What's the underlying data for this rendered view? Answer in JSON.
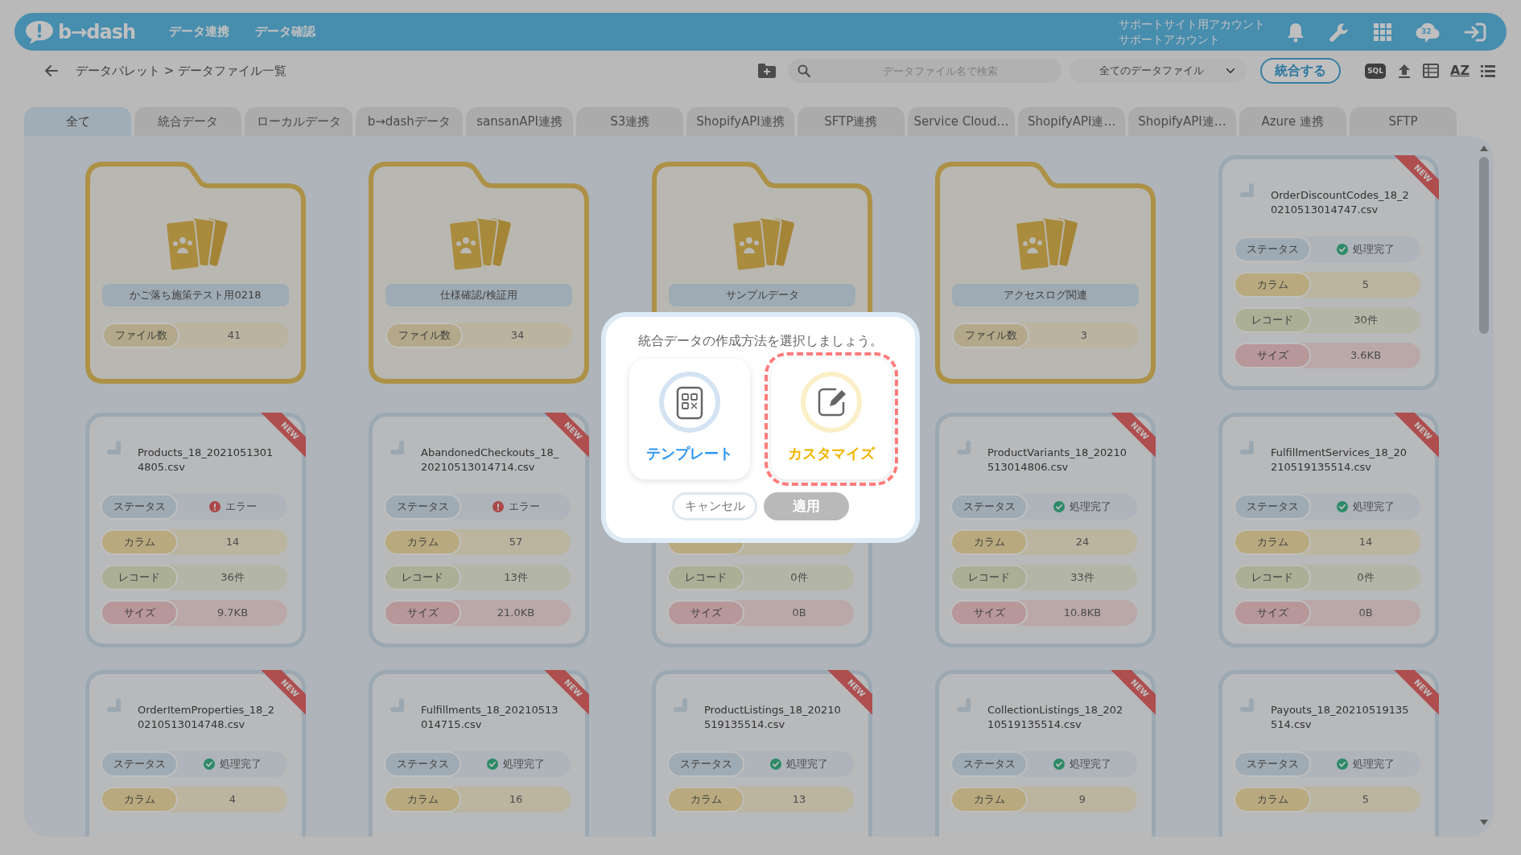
{
  "header": {
    "logo": "b→dash",
    "nav": [
      {
        "label": "データ連携"
      },
      {
        "label": "データ確認"
      }
    ],
    "account": [
      "サポートサイト用アカウント",
      "サポートアカウント"
    ],
    "badge": "32"
  },
  "toolbar": {
    "breadcrumb": "データパレット > データファイル一覧",
    "search": {
      "placeholder": "データファイル名で検索"
    },
    "filter": "全てのデータファイル",
    "merge_button": "統合する",
    "sql_button": "SQL",
    "sort_button": "AZ"
  },
  "tabs": [
    {
      "label": "全て",
      "selected": true
    },
    {
      "label": "統合データ",
      "selected": false
    },
    {
      "label": "ローカルデータ",
      "selected": false
    },
    {
      "label": "b→dashデータ",
      "selected": false
    },
    {
      "label": "sansanAPI連携",
      "selected": false
    },
    {
      "label": "S3連携",
      "selected": false
    },
    {
      "label": "ShopifyAPI連携",
      "selected": false
    },
    {
      "label": "SFTP連携",
      "selected": false
    },
    {
      "label": "Service Cloud…",
      "selected": false
    },
    {
      "label": "ShopifyAPI連…",
      "selected": false
    },
    {
      "label": "ShopifyAPI連…",
      "selected": false
    },
    {
      "label": "Azure 連携",
      "selected": false
    },
    {
      "label": "SFTP",
      "selected": false
    }
  ],
  "items": [
    {
      "kind": "folder",
      "name": "かご落ち施策テスト用0218",
      "count_label": "ファイル数",
      "count": "41"
    },
    {
      "kind": "folder",
      "name": "仕様確認/検証用",
      "count_label": "ファイル数",
      "count": "34"
    },
    {
      "kind": "folder",
      "name": "サンプルデータ"
    },
    {
      "kind": "folder",
      "name": "アクセスログ関連",
      "count_label": "ファイル数",
      "count": "3"
    },
    {
      "kind": "file",
      "name": "OrderDiscountCodes_18_20210513014747.csv",
      "ribbon": "NEW",
      "rows": [
        {
          "kind": "status",
          "label": "ステータス",
          "value": "処理完了",
          "error": false
        },
        {
          "kind": "column",
          "label": "カラム",
          "value": "5"
        },
        {
          "kind": "record",
          "label": "レコード",
          "value": "30件"
        },
        {
          "kind": "size",
          "label": "サイズ",
          "value": "3.6KB"
        }
      ]
    },
    {
      "kind": "file",
      "name": "Products_18_20210513014805.csv",
      "ribbon": "NEW",
      "rows": [
        {
          "kind": "status",
          "label": "ステータス",
          "value": "エラー",
          "error": true
        },
        {
          "kind": "column",
          "label": "カラム",
          "value": "14"
        },
        {
          "kind": "record",
          "label": "レコード",
          "value": "36件"
        },
        {
          "kind": "size",
          "label": "サイズ",
          "value": "9.7KB"
        }
      ]
    },
    {
      "kind": "file",
      "name": "AbandonedCheckouts_18_20210513014714.csv",
      "ribbon": "NEW",
      "rows": [
        {
          "kind": "status",
          "label": "ステータス",
          "value": "エラー",
          "error": true
        },
        {
          "kind": "column",
          "label": "カラム",
          "value": "57"
        },
        {
          "kind": "record",
          "label": "レコード",
          "value": "13件"
        },
        {
          "kind": "size",
          "label": "サイズ",
          "value": "21.0KB"
        }
      ]
    },
    {
      "kind": "file",
      "rows": [
        {
          "kind": "column"
        },
        {
          "kind": "record",
          "label": "レコード",
          "value": "0件"
        },
        {
          "kind": "size",
          "label": "サイズ",
          "value": "0B"
        }
      ]
    },
    {
      "kind": "file",
      "name": "ProductVariants_18_20210513014806.csv",
      "ribbon": "NEW",
      "rows": [
        {
          "kind": "status",
          "label": "ステータス",
          "value": "処理完了",
          "error": false
        },
        {
          "kind": "column",
          "label": "カラム",
          "value": "24"
        },
        {
          "kind": "record",
          "label": "レコード",
          "value": "33件"
        },
        {
          "kind": "size",
          "label": "サイズ",
          "value": "10.8KB"
        }
      ]
    },
    {
      "kind": "file",
      "name": "FulfillmentServices_18_20210519135514.csv",
      "ribbon": "NEW",
      "rows": [
        {
          "kind": "status",
          "label": "ステータス",
          "value": "処理完了",
          "error": false
        },
        {
          "kind": "column",
          "label": "カラム",
          "value": "14"
        },
        {
          "kind": "record",
          "label": "レコード",
          "value": "0件"
        },
        {
          "kind": "size",
          "label": "サイズ",
          "value": "0B"
        }
      ]
    },
    {
      "kind": "file",
      "name": "OrderItemProperties_18_20210513014748.csv",
      "ribbon": "NEW",
      "rows": [
        {
          "kind": "status",
          "label": "ステータス",
          "value": "処理完了",
          "error": false
        },
        {
          "kind": "column",
          "label": "カラム",
          "value": "4"
        }
      ]
    },
    {
      "kind": "file",
      "name": "Fulfillments_18_20210513014715.csv",
      "ribbon": "NEW",
      "rows": [
        {
          "kind": "status",
          "label": "ステータス",
          "value": "処理完了",
          "error": false
        },
        {
          "kind": "column",
          "label": "カラム",
          "value": "16"
        }
      ]
    },
    {
      "kind": "file",
      "name": "ProductListings_18_20210519135514.csv",
      "ribbon": "NEW",
      "rows": [
        {
          "kind": "status",
          "label": "ステータス",
          "value": "処理完了",
          "error": false
        },
        {
          "kind": "column",
          "label": "カラム",
          "value": "13"
        }
      ]
    },
    {
      "kind": "file",
      "name": "CollectionListings_18_20210519135514.csv",
      "ribbon": "NEW",
      "rows": [
        {
          "kind": "status",
          "label": "ステータス",
          "value": "処理完了",
          "error": false
        },
        {
          "kind": "column",
          "label": "カラム",
          "value": "9"
        }
      ]
    },
    {
      "kind": "file",
      "name": "Payouts_18_20210519135514.csv",
      "ribbon": "NEW",
      "rows": [
        {
          "kind": "status",
          "label": "ステータス",
          "value": "処理完了",
          "error": false
        },
        {
          "kind": "column",
          "label": "カラム",
          "value": "5"
        }
      ]
    }
  ],
  "modal": {
    "title": "統合データの作成方法を選択しましょう。",
    "options": [
      {
        "kind": "template",
        "label": "テンプレート",
        "selected": false
      },
      {
        "kind": "custom",
        "label": "カスタマイズ",
        "selected": true
      }
    ],
    "buttons": [
      {
        "kind": "cancel",
        "label": "キャンセル",
        "disabled": false
      },
      {
        "kind": "apply",
        "label": "適用",
        "disabled": true
      }
    ]
  }
}
